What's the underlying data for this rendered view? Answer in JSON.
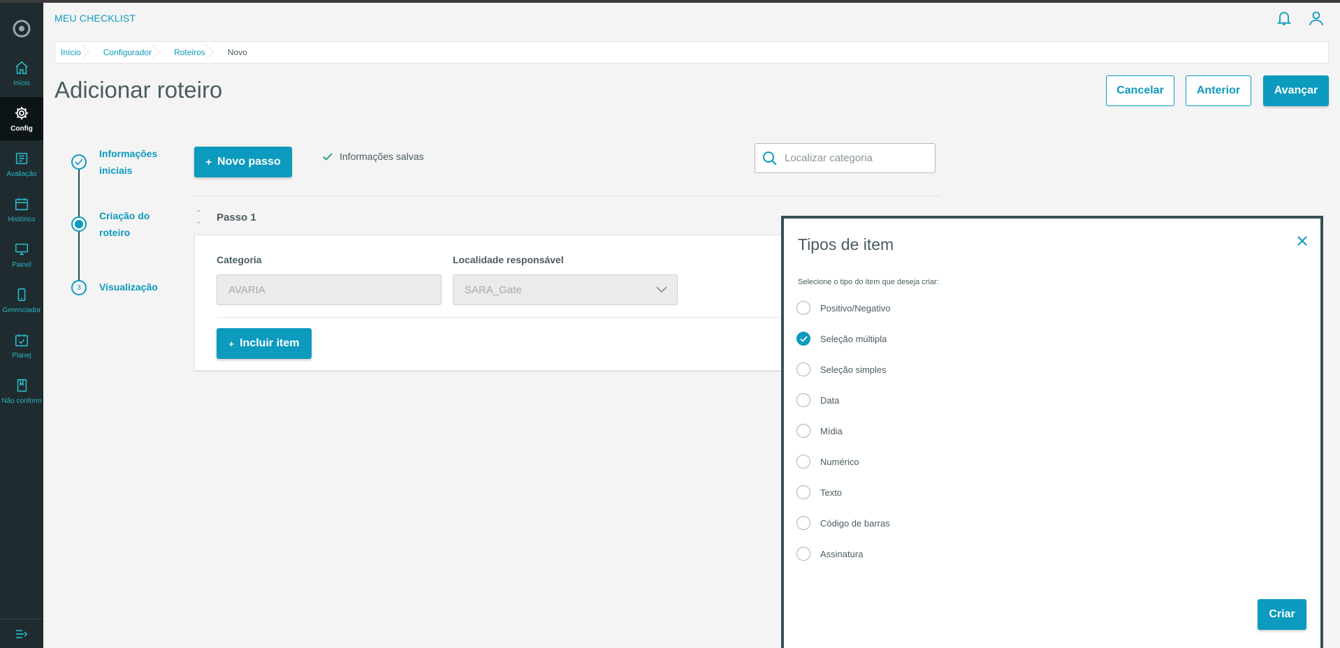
{
  "app": {
    "title": "MEU CHECKLIST"
  },
  "sidebar": {
    "items": [
      {
        "label": "Início",
        "icon": "home-icon"
      },
      {
        "label": "Config",
        "icon": "gear-icon",
        "active": true
      },
      {
        "label": "Avaliação",
        "icon": "evaluation-icon"
      },
      {
        "label": "Histórico",
        "icon": "calendar-icon"
      },
      {
        "label": "Painel",
        "icon": "monitor-icon"
      },
      {
        "label": "Gerenciador",
        "icon": "mobile-icon"
      },
      {
        "label": "Planej",
        "icon": "calendar-check-icon"
      },
      {
        "label": "Não conform",
        "icon": "book-icon"
      }
    ]
  },
  "breadcrumb": [
    "Início",
    "Configurador",
    "Roteiros",
    "Novo"
  ],
  "page": {
    "title": "Adicionar roteiro",
    "actions": {
      "cancel": "Cancelar",
      "previous": "Anterior",
      "next": "Avançar"
    }
  },
  "stepper": [
    {
      "label_line1": "Informações",
      "label_line2": "iniciais",
      "state": "done"
    },
    {
      "label_line1": "Criação do",
      "label_line2": "roteiro",
      "state": "current"
    },
    {
      "label_line1": "Visualização",
      "label_line2": "",
      "number": "3",
      "state": "pending"
    }
  ],
  "toolbar": {
    "new_step": "Novo passo",
    "saved_status": "Informações salvas",
    "search_placeholder": "Localizar categoria"
  },
  "step": {
    "title": "Passo 1",
    "category_label": "Categoria",
    "category_value": "AVARIA",
    "location_label": "Localidade responsável",
    "location_value": "SARA_Gate",
    "include_item": "Incluir item"
  },
  "modal": {
    "title": "Tipos de item",
    "subtitle": "Selecione o tipo do item que deseja criar:",
    "options": [
      {
        "label": "Positivo/Negativo",
        "checked": false
      },
      {
        "label": "Seleção múltipla",
        "checked": true
      },
      {
        "label": "Seleção simples",
        "checked": false
      },
      {
        "label": "Data",
        "checked": false
      },
      {
        "label": "Mídia",
        "checked": false
      },
      {
        "label": "Numérico",
        "checked": false
      },
      {
        "label": "Texto",
        "checked": false
      },
      {
        "label": "Código de barras",
        "checked": false
      },
      {
        "label": "Assinatura",
        "checked": false
      }
    ],
    "create_button": "Criar"
  },
  "colors": {
    "primary": "#0c9abe",
    "sidebar": "#1f2b2e",
    "sidebar_active": "#0c1416",
    "modal_border": "#374f56"
  }
}
